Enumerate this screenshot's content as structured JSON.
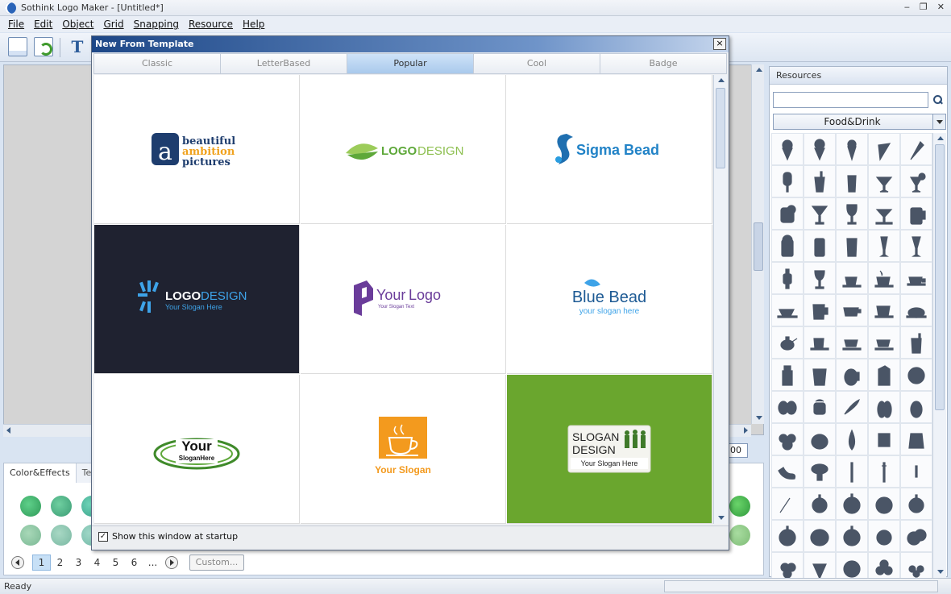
{
  "window": {
    "title": "Sothink Logo Maker - [Untitled*]"
  },
  "menu": [
    "File",
    "Edit",
    "Object",
    "Grid",
    "Snapping",
    "Resource",
    "Help"
  ],
  "lower_panel": {
    "tabs": [
      "Color&Effects",
      "Text"
    ],
    "pager": {
      "pages": [
        "1",
        "2",
        "3",
        "4",
        "5",
        "6",
        "..."
      ],
      "custom_label": "Custom..."
    }
  },
  "zoom_box": {
    "value": "00"
  },
  "status": {
    "text": "Ready"
  },
  "resources": {
    "title": "Resources",
    "search_value": "",
    "category": "Food&Drink"
  },
  "dialog": {
    "title": "New From Template",
    "close": "×",
    "tabs": [
      "Classic",
      "LetterBased",
      "Popular",
      "Cool",
      "Badge"
    ],
    "active_tab": "Popular",
    "templates": [
      {
        "name": "beautiful ambition pictures",
        "line1": "beautiful",
        "line2": "ambition",
        "line3": "pictures"
      },
      {
        "name": "LOGODESIGN green",
        "a": "LOGO",
        "b": "DESIGN"
      },
      {
        "name": "Sigma Bead",
        "text": "Sigma Bead"
      },
      {
        "name": "LOGODESIGN dark",
        "a": "LOGO",
        "b": "DESIGN",
        "slogan": "Your Slogan Here"
      },
      {
        "name": "YourLogo",
        "a": "Your",
        "b": "Logo",
        "slogan": "Your Slogan Text"
      },
      {
        "name": "Blue Bead",
        "text": "Blue Bead",
        "slogan": "your slogan here"
      },
      {
        "name": "Your SloganHere",
        "a": "Your",
        "b": "SloganHere"
      },
      {
        "name": "Your Slogan cup",
        "text": "Your Slogan"
      },
      {
        "name": "SLOGAN DESIGN",
        "a": "SLOGAN",
        "b": "DESIGN",
        "slogan": "Your Slogan Here"
      }
    ],
    "startup_checkbox": {
      "label": "Show this window at startup",
      "checked": true
    }
  },
  "colors": {
    "accent": "#2a64b8",
    "dialog_title": "#1d4787",
    "icon_fill": "#4a5566",
    "swatch": "#4fbf7a"
  }
}
